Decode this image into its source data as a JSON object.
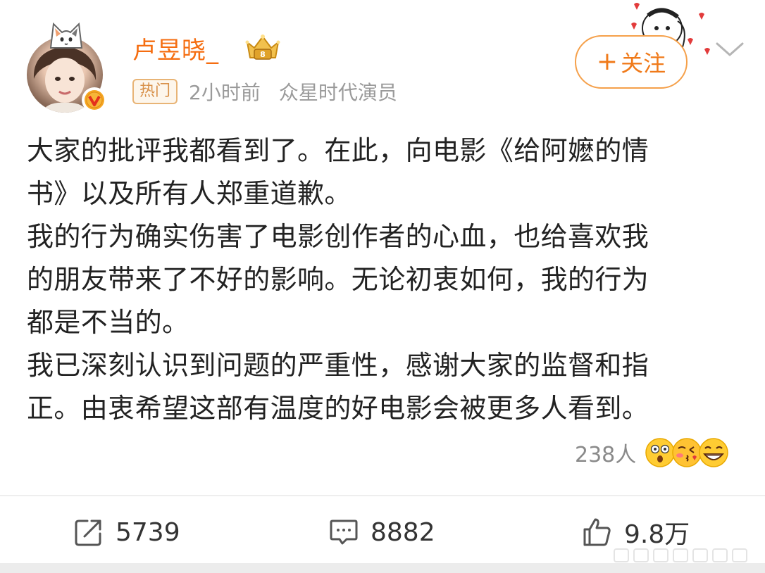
{
  "header": {
    "username": "卢昱晓_",
    "hot_label": "热门",
    "time_ago": "2小时前",
    "source": "众星时代演员",
    "follow_label": "关注"
  },
  "post": {
    "lines": [
      "大家的批评我都看到了。在此，向电影《给阿嬷的情",
      "书》以及所有人郑重道歉。",
      "我的行为确实伤害了电影创作者的心血，也给喜欢我",
      "的朋友带来了不好的影响。无论初衷如何，我的行为",
      "都是不当的。",
      "我已深刻认识到问题的严重性，感谢大家的监督和指",
      "正。由衷希望这部有温度的好电影会被更多人看到。"
    ]
  },
  "reactions": {
    "count": "238人",
    "emojis": [
      "shocked-face-icon",
      "blowing-kiss-face-icon",
      "grinning-face-icon"
    ]
  },
  "actions": {
    "repost_count": "5739",
    "comment_count": "8882",
    "like_count": "9.8万"
  },
  "colors": {
    "username": "#f56d10",
    "follow_accent": "#f07a1a",
    "hot_badge": "#d8914a",
    "meta": "#9a9a9a"
  }
}
